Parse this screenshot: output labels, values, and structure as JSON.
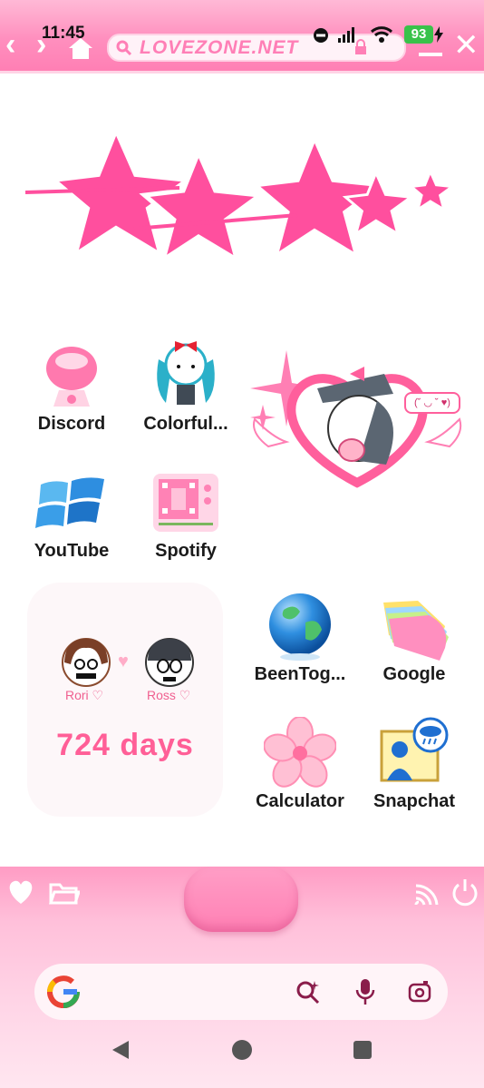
{
  "status_bar": {
    "time": "11:45",
    "battery": "93"
  },
  "browser_bar": {
    "url": "LOVEZONE.NET"
  },
  "apps": [
    {
      "label": "Discord"
    },
    {
      "label": "Colorful..."
    },
    {
      "label": "YouTube"
    },
    {
      "label": "Spotify"
    },
    {
      "label": "BeenTog..."
    },
    {
      "label": "Google"
    },
    {
      "label": "Calculator"
    },
    {
      "label": "Snapchat"
    }
  ],
  "couple_widget": {
    "left_name": "Rori ♡",
    "right_name": "Ross ♡",
    "days": "724 days"
  },
  "sticker": {
    "speech_text": "(˘ ◡ ˘ ♥)"
  },
  "colors": {
    "accent_pink": "#ff6fa8",
    "dock_pink": "#ffb6d3"
  }
}
